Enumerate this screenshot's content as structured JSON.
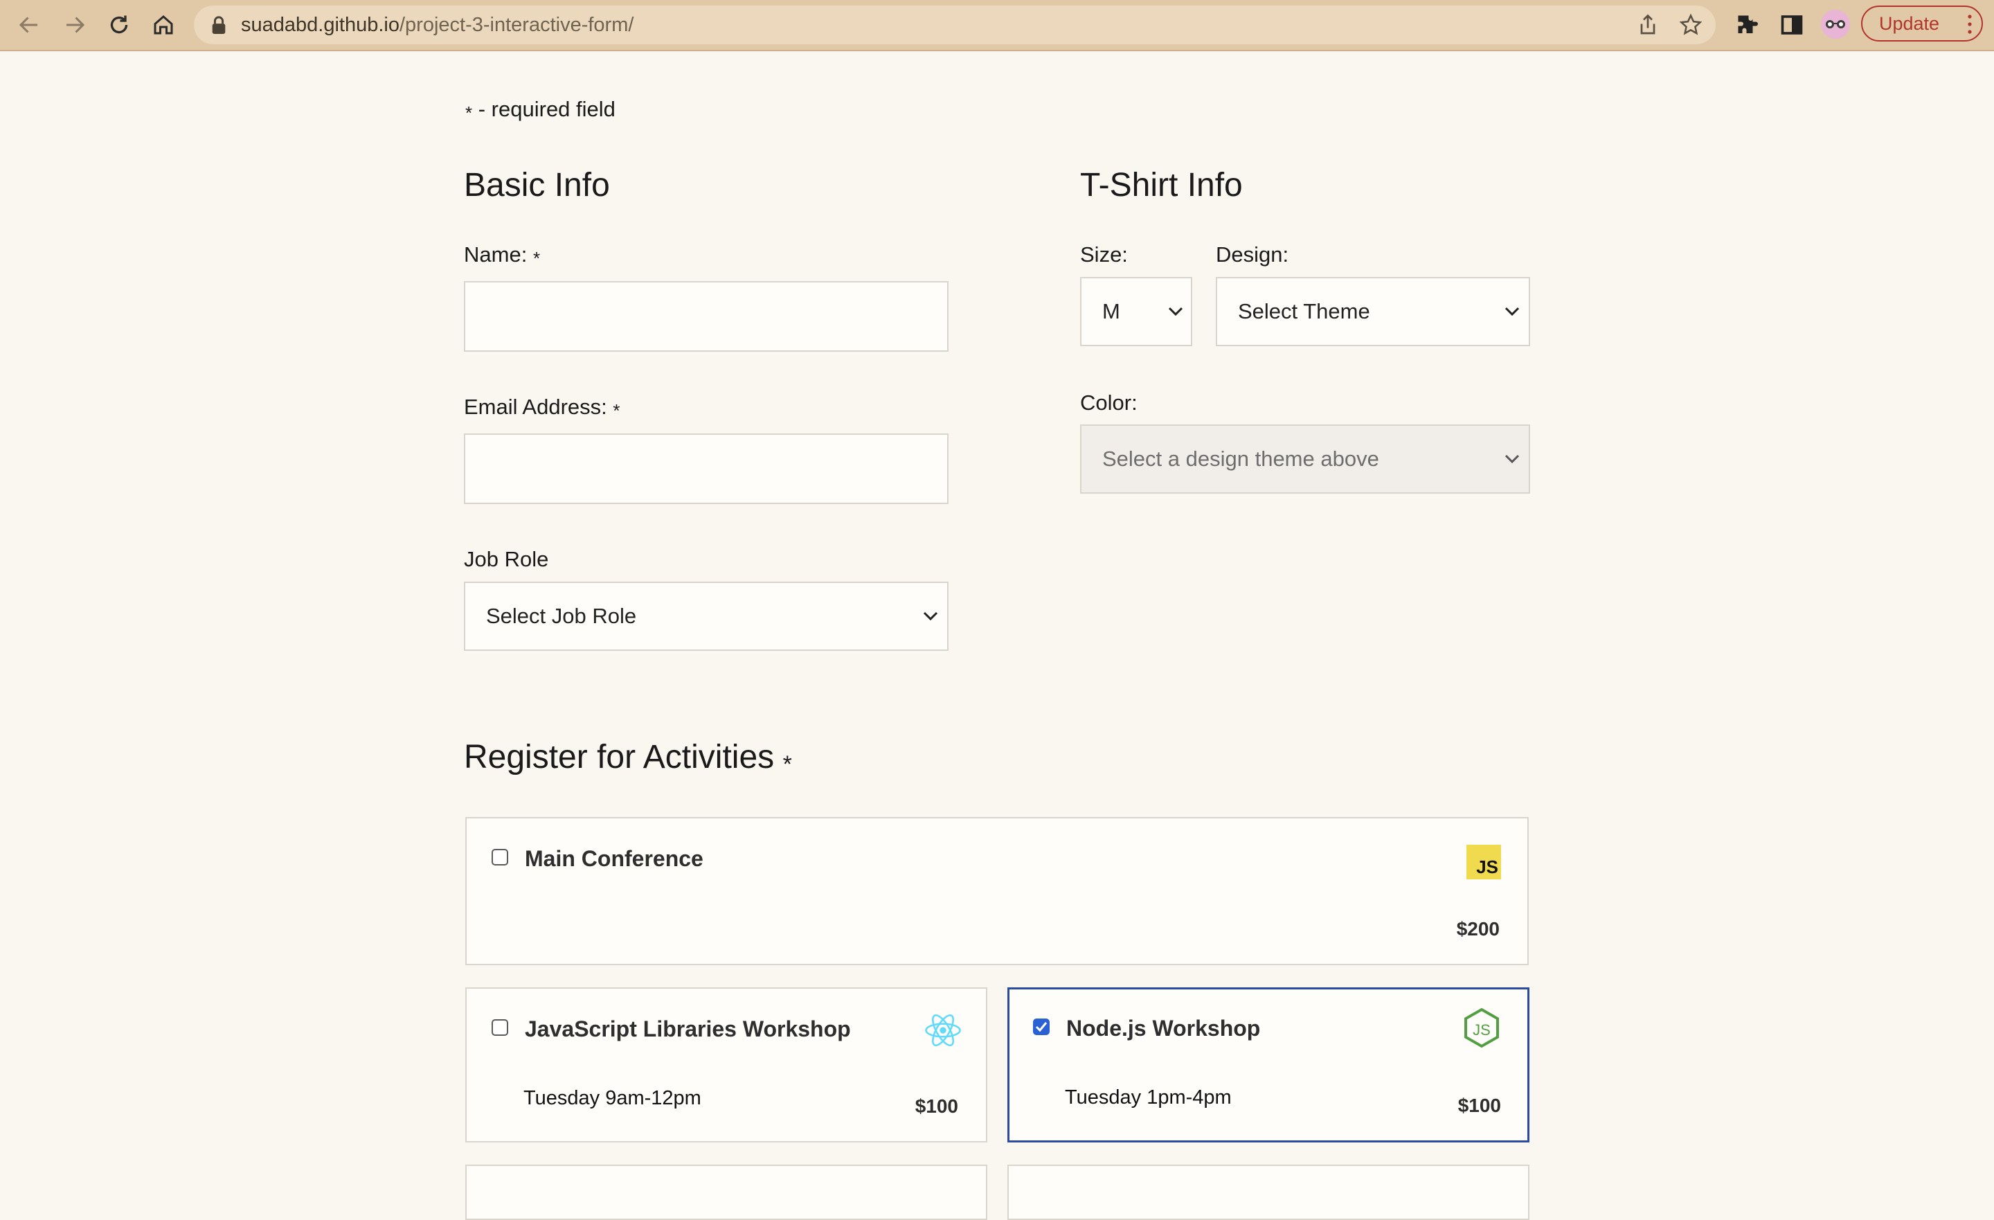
{
  "browser": {
    "url_host": "suadabd.github.io",
    "url_path": "/project-3-interactive-form/",
    "update_label": "Update",
    "icons": [
      "back-icon",
      "forward-icon",
      "reload-icon",
      "home-icon",
      "lock-icon",
      "share-icon",
      "star-icon",
      "extensions-icon",
      "sidepanel-icon",
      "profile-avatar",
      "more-icon"
    ]
  },
  "form": {
    "required_note": "- required field",
    "required_mark": "*",
    "basic_info": {
      "heading": "Basic Info",
      "name_label": "Name:",
      "email_label": "Email Address:",
      "job_role_label": "Job Role",
      "job_role_value": "Select Job Role"
    },
    "tshirt_info": {
      "heading": "T-Shirt Info",
      "size_label": "Size:",
      "size_value": "M",
      "design_label": "Design:",
      "design_value": "Select Theme",
      "color_label": "Color:",
      "color_value": "Select a design theme above"
    },
    "activities": {
      "heading": "Register for Activities",
      "items": [
        {
          "title": "Main Conference",
          "time": "",
          "cost": "$200",
          "checked": false,
          "logo": "js-logo"
        },
        {
          "title": "JavaScript Libraries Workshop",
          "time": "Tuesday 9am-12pm",
          "cost": "$100",
          "checked": false,
          "logo": "react-logo"
        },
        {
          "title": "Node.js Workshop",
          "time": "Tuesday 1pm-4pm",
          "cost": "$100",
          "checked": true,
          "logo": "nodejs-logo"
        }
      ]
    }
  },
  "colors": {
    "page_bg": "#faf6f0",
    "toolbar_bg": "#e1c8a7",
    "checked_border": "#2b4aa3",
    "checkbox_checked": "#2a62d6",
    "update_red": "#b1352c",
    "react_cyan": "#61dafb",
    "node_green": "#539e43"
  }
}
